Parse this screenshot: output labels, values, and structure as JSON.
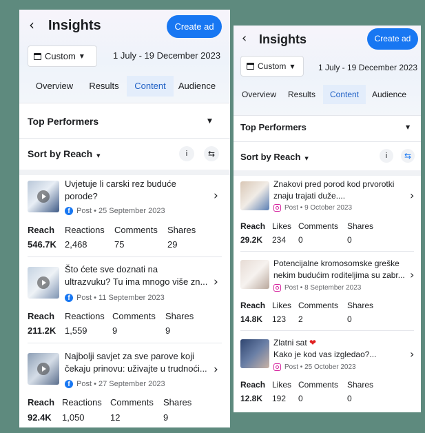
{
  "left": {
    "header": {
      "title": "Insights",
      "create_ad": "Create ad",
      "date_filter": "Custom",
      "date_range": "1 July - 19 December 2023",
      "tabs": [
        "Overview",
        "Results",
        "Content",
        "Audience"
      ],
      "active_tab": "Content"
    },
    "section_title": "Top Performers",
    "sort_label": "Sort by Reach",
    "info_label": "i",
    "metric_labels": [
      "Reach",
      "Reactions",
      "Comments",
      "Shares"
    ],
    "posts": [
      {
        "title_line1": "Uvjetuje li carski rez buduće",
        "title_line2": "porode?",
        "platform": "facebook",
        "meta": "Post • 25 September 2023",
        "metrics": [
          "546.7K",
          "2,468",
          "75",
          "29"
        ]
      },
      {
        "title_line1": "Što ćete sve doznati na",
        "title_line2": "ultrazvuku? Tu ima mnogo više zn...",
        "platform": "facebook",
        "meta": "Post • 11 September 2023",
        "metrics": [
          "211.2K",
          "1,559",
          "9",
          "9"
        ]
      },
      {
        "title_line1": "Najbolji savjet za sve parove koji",
        "title_line2": "čekaju prinovu: uživajte u trudnoći...",
        "platform": "facebook",
        "meta": "Post • 27 September 2023",
        "metrics": [
          "92.4K",
          "1,050",
          "12",
          "9"
        ]
      }
    ]
  },
  "right": {
    "header": {
      "title": "Insights",
      "create_ad": "Create ad",
      "date_filter": "Custom",
      "date_range": "1 July - 19 December 2023",
      "tabs": [
        "Overview",
        "Results",
        "Content",
        "Audience"
      ],
      "active_tab": "Content"
    },
    "section_title": "Top Performers",
    "sort_label": "Sort by Reach",
    "info_label": "i",
    "metric_labels": [
      "Reach",
      "Likes",
      "Comments",
      "Shares"
    ],
    "posts": [
      {
        "title_line1": "Znakovi pred porod kod prvorotki",
        "title_line2": "znaju trajati duže....",
        "platform": "instagram",
        "meta": "Post • 9 October 2023",
        "metrics": [
          "29.2K",
          "234",
          "0",
          "0"
        ]
      },
      {
        "title_line1": "Potencijalne kromosomske greške",
        "title_line2": "nekim budućim roditeljima su zabr...",
        "platform": "instagram",
        "meta": "Post • 8 September 2023",
        "metrics": [
          "14.8K",
          "123",
          "2",
          "0"
        ]
      },
      {
        "title_line1": "Zlatni sat",
        "title_line2": "Kako je kod vas izgledao?...",
        "title_emoji": "❤",
        "platform": "instagram",
        "meta": "Post • 25 October 2023",
        "metrics": [
          "12.8K",
          "192",
          "0",
          "0"
        ]
      }
    ]
  },
  "colors": {
    "accent": "#1877f2",
    "active_tab_bg": "#e3edfb",
    "background": "#5e8a7e",
    "section_band": "#f0f2f5"
  }
}
